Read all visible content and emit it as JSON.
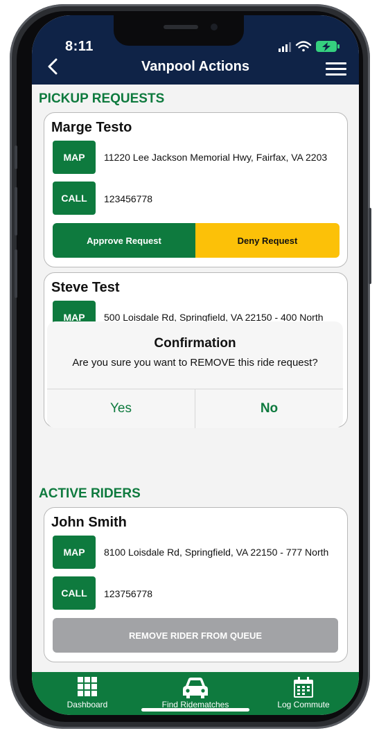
{
  "status_bar": {
    "time": "8:11"
  },
  "header": {
    "title": "Vanpool Actions"
  },
  "pickup": {
    "section_title": "PICKUP REQUESTS",
    "cards": [
      {
        "name": "Marge Testo",
        "map_label": "MAP",
        "address": "11220 Lee Jackson Memorial Hwy, Fairfax, VA 2203",
        "call_label": "CALL",
        "phone": "123456778",
        "approve_label": "Approve Request",
        "deny_label": "Deny Request"
      },
      {
        "name": "Steve Test",
        "map_label": "MAP",
        "address": "500 Loisdale Rd, Springfield, VA 22150 - 400 North"
      }
    ]
  },
  "dialog": {
    "title": "Confirmation",
    "message": "Are you sure you want to REMOVE this ride request?",
    "yes_label": "Yes",
    "no_label": "No"
  },
  "active": {
    "section_title": "ACTIVE RIDERS",
    "cards": [
      {
        "name": "John Smith",
        "map_label": "MAP",
        "address": "8100 Loisdale Rd, Springfield, VA 22150 - 777 North",
        "call_label": "CALL",
        "phone": "123756778",
        "remove_label": "REMOVE RIDER FROM QUEUE"
      }
    ]
  },
  "tabbar": {
    "items": [
      {
        "label": "Dashboard",
        "icon": "grid-icon"
      },
      {
        "label": "Find Ridematches",
        "icon": "car-icon"
      },
      {
        "label": "Log Commute",
        "icon": "calendar-icon"
      }
    ]
  },
  "colors": {
    "header_bg": "#0f2347",
    "accent_green": "#0e7a3e",
    "deny_yellow": "#fcc108",
    "remove_gray": "#a2a3a6"
  }
}
